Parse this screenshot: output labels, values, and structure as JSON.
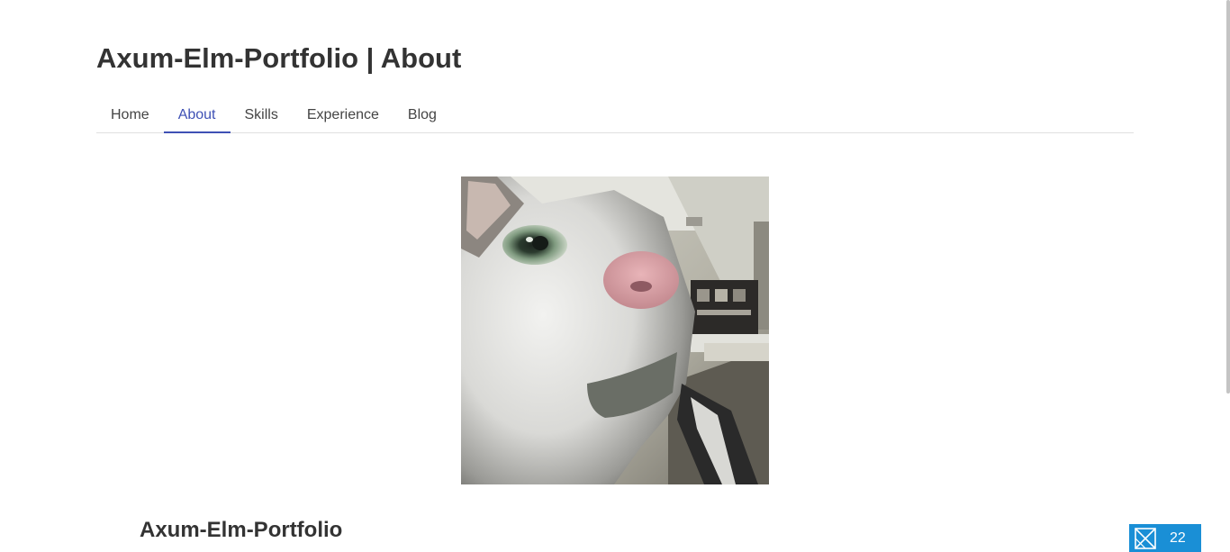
{
  "header": {
    "title": "Axum-Elm-Portfolio | About"
  },
  "nav": {
    "tabs": [
      {
        "label": "Home",
        "active": false
      },
      {
        "label": "About",
        "active": true
      },
      {
        "label": "Skills",
        "active": false
      },
      {
        "label": "Experience",
        "active": false
      },
      {
        "label": "Blog",
        "active": false
      }
    ],
    "active_color": "#3f51b5"
  },
  "main": {
    "photo_subject": "cat-photo",
    "section_title": "Axum-Elm-Portfolio"
  },
  "badge": {
    "icon": "envelope-logo-icon",
    "count": "22",
    "color": "#1a8fd6"
  }
}
